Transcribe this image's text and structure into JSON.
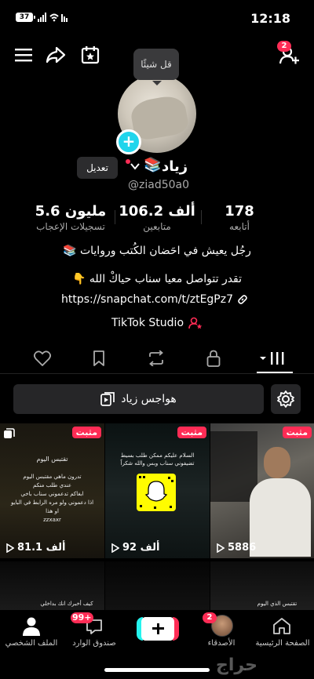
{
  "status": {
    "battery": "37",
    "time": "12:18"
  },
  "header": {
    "tooltip": "قل شيئًا",
    "notif_badge": "2"
  },
  "profile": {
    "edit": "تعديل",
    "name": "زياد",
    "name_emoji": "📚",
    "handle": "@ziad50a0",
    "stats": [
      {
        "value": "178",
        "label": "أتابعه"
      },
      {
        "value": "106.2 ألف",
        "label": "متابعين"
      },
      {
        "value": "5.6 مليون",
        "label": "تسجيلات الإعجاب"
      }
    ],
    "bio_line1": "رجُل يعيش في احَضان الكُتب وروايات 📚",
    "bio_line2": "تقدر تتواصل معيا سناب حياكْ الله 👇",
    "link": "https://snapchat.com/t/ztEgPz7",
    "studio": "TikTok Studio"
  },
  "search_button": "هواجس زياد",
  "grid": [
    {
      "pinned": "مثبت",
      "views": "81.1 ألف",
      "overlay": [
        "تقتبس اليوم",
        "تدرون ماهي مقتبس اليوم",
        "عندي طلب منكم",
        "ابغاكم تدعموني سناب باخي",
        "اذا دعموني ولو مره الرابط في البايو",
        "او هذا",
        "zzxaxr"
      ]
    },
    {
      "pinned": "مثبت",
      "views": "92 ألف",
      "overlay": [
        "السلام عليكم ممكن طلب بسيط",
        "تضيفوني سناب وبس والله شكراً"
      ]
    },
    {
      "pinned": "مثبت",
      "views": "5886",
      "overlay": []
    },
    {
      "overlay": [
        "كيف أخبرك انك بداخلي"
      ]
    },
    {
      "overlay": []
    },
    {
      "overlay": [
        "تقتبس الذي اليوم"
      ]
    }
  ],
  "bottom_nav": {
    "profile": "الملف الشخصي",
    "inbox": "صندوق الوارد",
    "inbox_badge": "99+",
    "friends": "الأصدقاء",
    "friends_badge": "2",
    "home": "الصفحة الرئيسية"
  },
  "watermark": "حراج"
}
